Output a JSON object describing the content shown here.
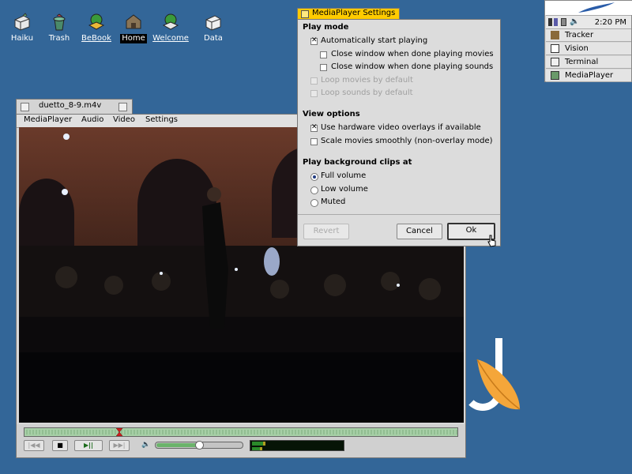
{
  "desktop": {
    "icons": [
      {
        "id": "haiku",
        "label": "Haiku"
      },
      {
        "id": "trash",
        "label": "Trash"
      },
      {
        "id": "bebook",
        "label": "BeBook"
      },
      {
        "id": "home",
        "label": "Home"
      },
      {
        "id": "welcome",
        "label": "Welcome"
      },
      {
        "id": "data",
        "label": "Data"
      }
    ]
  },
  "deskbar": {
    "clock": "2:20 PM",
    "items": [
      {
        "label": "Tracker"
      },
      {
        "label": "Vision"
      },
      {
        "label": "Terminal"
      },
      {
        "label": "MediaPlayer"
      }
    ]
  },
  "player": {
    "title": "duetto_8-9.m4v",
    "menu": [
      "MediaPlayer",
      "Audio",
      "Video",
      "Settings"
    ],
    "position": 0.215,
    "volume": 0.5
  },
  "settings": {
    "title": "MediaPlayer Settings",
    "play_mode": {
      "heading": "Play mode",
      "auto_start": "Automatically start playing",
      "close_movies": "Close window when done playing movies",
      "close_sounds": "Close window when done playing sounds",
      "loop_movies": "Loop movies by default",
      "loop_sounds": "Loop sounds by default"
    },
    "view_options": {
      "heading": "View options",
      "hw_overlays": "Use hardware video overlays if available",
      "scale_smooth": "Scale movies smoothly (non-overlay mode)"
    },
    "bg_clips": {
      "heading": "Play background clips at",
      "full": "Full volume",
      "low": "Low volume",
      "muted": "Muted"
    },
    "buttons": {
      "revert": "Revert",
      "cancel": "Cancel",
      "ok": "Ok"
    }
  },
  "colors": {
    "desktop": "#336698",
    "tab_active": "#ffcb00",
    "tab_inactive": "#d4d4d4"
  }
}
